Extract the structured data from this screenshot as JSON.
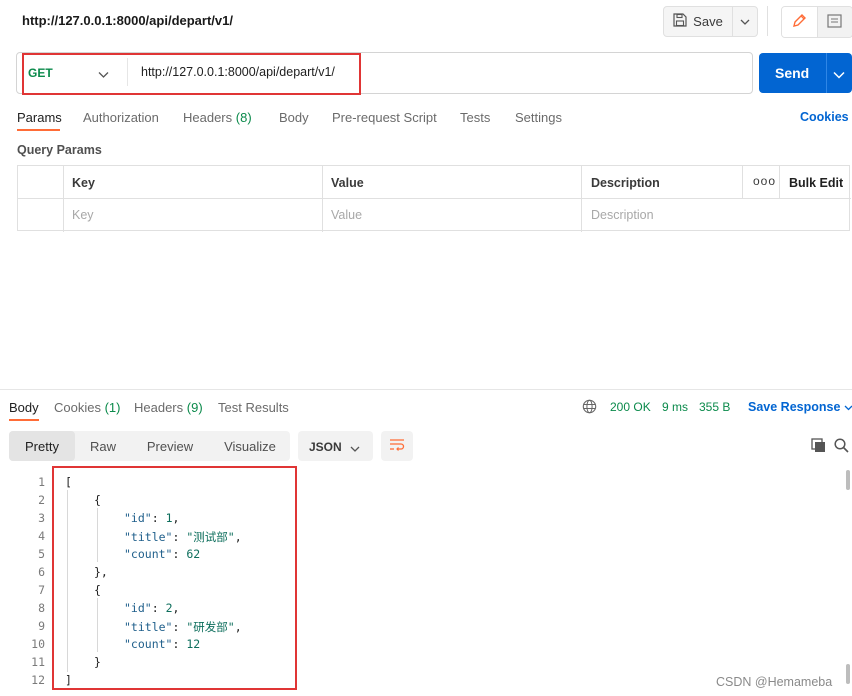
{
  "header": {
    "request_title": "http://127.0.0.1:8000/api/depart/v1/",
    "save_label": "Save"
  },
  "request": {
    "method": "GET",
    "url": "http://127.0.0.1:8000/api/depart/v1/",
    "send_label": "Send"
  },
  "request_tabs": {
    "params": "Params",
    "authorization": "Authorization",
    "headers": "Headers",
    "headers_count": "(8)",
    "body": "Body",
    "pre_request": "Pre-request Script",
    "tests": "Tests",
    "settings": "Settings",
    "cookies": "Cookies"
  },
  "params": {
    "section_label": "Query Params",
    "columns": {
      "key": "Key",
      "value": "Value",
      "description": "Description"
    },
    "more_label": "ooo",
    "bulk_edit": "Bulk Edit",
    "placeholders": {
      "key": "Key",
      "value": "Value",
      "description": "Description"
    }
  },
  "response": {
    "tabs": {
      "body": "Body",
      "cookies": "Cookies",
      "cookies_count": "(1)",
      "headers": "Headers",
      "headers_count": "(9)",
      "test_results": "Test Results"
    },
    "status": "200 OK",
    "time": "9 ms",
    "size": "355 B",
    "save_response": "Save Response",
    "view_modes": {
      "pretty": "Pretty",
      "raw": "Raw",
      "preview": "Preview",
      "visualize": "Visualize"
    },
    "format": "JSON",
    "line_numbers": [
      "1",
      "2",
      "3",
      "4",
      "5",
      "6",
      "7",
      "8",
      "9",
      "10",
      "11",
      "12"
    ],
    "body_items": [
      {
        "id": "1",
        "title": "\"测试部\"",
        "count": "62"
      },
      {
        "id": "2",
        "title": "\"研发部\"",
        "count": "12"
      }
    ]
  },
  "watermark": "CSDN @Hemameba"
}
